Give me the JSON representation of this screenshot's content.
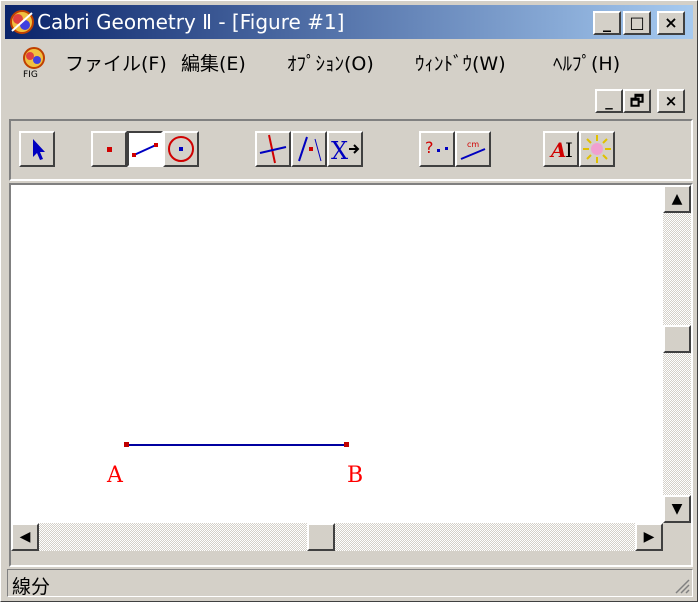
{
  "window": {
    "title": "Cabri Geometry Ⅱ - [Figure #1]",
    "controls": [
      "_",
      "□",
      "×"
    ]
  },
  "menubar": {
    "items": [
      {
        "label": "ファイル(F)"
      },
      {
        "label": "編集(E)"
      },
      {
        "label": "ｵﾌﾟｼｮﾝ(O)"
      },
      {
        "label": "ｳｨﾝﾄﾞｳ(W)"
      },
      {
        "label": "ﾍﾙﾌﾟ(H)"
      }
    ],
    "mdi_controls": [
      "_",
      "🗗",
      "×"
    ]
  },
  "toolbar": {
    "tools": [
      {
        "name": "pointer",
        "icon": "arrow-pointer-icon"
      },
      {
        "name": "point",
        "icon": "point-icon"
      },
      {
        "name": "segment",
        "icon": "segment-icon",
        "active": true
      },
      {
        "name": "circle",
        "icon": "circle-icon"
      },
      {
        "name": "perpendicular",
        "icon": "perpendicular-line-icon"
      },
      {
        "name": "construct",
        "icon": "construction-icon"
      },
      {
        "name": "transform",
        "icon": "transform-icon"
      },
      {
        "name": "check-property",
        "icon": "check-property-icon"
      },
      {
        "name": "measure",
        "icon": "measure-distance-icon"
      },
      {
        "name": "display",
        "icon": "label-icon"
      },
      {
        "name": "draw",
        "icon": "draw-style-icon"
      }
    ]
  },
  "canvas": {
    "points": [
      {
        "label": "A"
      },
      {
        "label": "B"
      }
    ],
    "segment_color": "#0000a0",
    "point_color": "#c00000",
    "label_color": "#ff0000"
  },
  "statusbar": {
    "text": "線分"
  }
}
